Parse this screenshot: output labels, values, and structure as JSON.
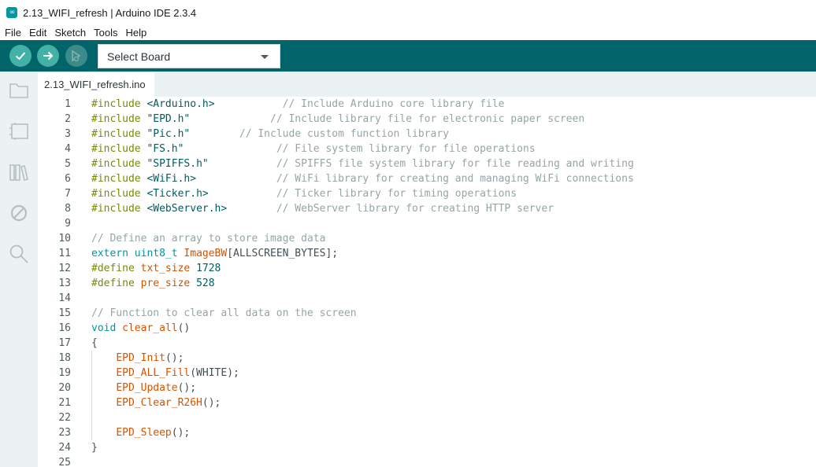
{
  "window": {
    "title": "2.13_WIFI_refresh | Arduino IDE 2.3.4",
    "logo_text": "∞"
  },
  "menu": [
    "File",
    "Edit",
    "Sketch",
    "Tools",
    "Help"
  ],
  "toolbar": {
    "verify_icon": "check-icon",
    "upload_icon": "arrow-right-icon",
    "debug_icon": "debug-icon",
    "board_select": "Select Board"
  },
  "sidebar": [
    "folder-icon",
    "board-manager-icon",
    "library-icon",
    "debug-off-icon",
    "search-icon"
  ],
  "tab": {
    "label": "2.13_WIFI_refresh.ino"
  },
  "code_lines": [
    {
      "n": "1",
      "indent": 0,
      "tokens": [
        [
          "pre",
          "#include "
        ],
        [
          "str",
          "<Arduino.h>"
        ],
        [
          "sp",
          "           "
        ],
        [
          "cmt",
          "// Include Arduino core library file"
        ]
      ]
    },
    {
      "n": "2",
      "indent": 0,
      "tokens": [
        [
          "pre",
          "#include "
        ],
        [
          "str",
          "\"EPD.h\""
        ],
        [
          "sp",
          "             "
        ],
        [
          "cmt",
          "// Include library file for electronic paper screen"
        ]
      ]
    },
    {
      "n": "3",
      "indent": 0,
      "tokens": [
        [
          "pre",
          "#include "
        ],
        [
          "str",
          "\"Pic.h\""
        ],
        [
          "sp",
          "        "
        ],
        [
          "cmt",
          "// Include custom function library"
        ]
      ]
    },
    {
      "n": "4",
      "indent": 0,
      "tokens": [
        [
          "pre",
          "#include "
        ],
        [
          "str",
          "\"FS.h\""
        ],
        [
          "sp",
          "               "
        ],
        [
          "cmt",
          "// File system library for file operations"
        ]
      ]
    },
    {
      "n": "5",
      "indent": 0,
      "tokens": [
        [
          "pre",
          "#include "
        ],
        [
          "str",
          "\"SPIFFS.h\""
        ],
        [
          "sp",
          "           "
        ],
        [
          "cmt",
          "// SPIFFS file system library for file reading and writing"
        ]
      ]
    },
    {
      "n": "6",
      "indent": 0,
      "tokens": [
        [
          "pre",
          "#include "
        ],
        [
          "str",
          "<WiFi.h>"
        ],
        [
          "sp",
          "             "
        ],
        [
          "cmt",
          "// WiFi library for creating and managing WiFi connections"
        ]
      ]
    },
    {
      "n": "7",
      "indent": 0,
      "tokens": [
        [
          "pre",
          "#include "
        ],
        [
          "str",
          "<Ticker.h>"
        ],
        [
          "sp",
          "           "
        ],
        [
          "cmt",
          "// Ticker library for timing operations"
        ]
      ]
    },
    {
      "n": "8",
      "indent": 0,
      "tokens": [
        [
          "pre",
          "#include "
        ],
        [
          "str",
          "<WebServer.h>"
        ],
        [
          "sp",
          "        "
        ],
        [
          "cmt",
          "// WebServer library for creating HTTP server"
        ]
      ]
    },
    {
      "n": "9",
      "indent": 0,
      "tokens": []
    },
    {
      "n": "10",
      "indent": 0,
      "tokens": [
        [
          "cmt",
          "// Define an array to store image data"
        ]
      ]
    },
    {
      "n": "11",
      "indent": 0,
      "tokens": [
        [
          "kw",
          "extern "
        ],
        [
          "kw",
          "uint8_t "
        ],
        [
          "fn",
          "ImageBW"
        ],
        [
          "id",
          "[ALLSCREEN_BYTES];"
        ]
      ]
    },
    {
      "n": "12",
      "indent": 0,
      "tokens": [
        [
          "pre",
          "#define "
        ],
        [
          "fn",
          "txt_size "
        ],
        [
          "num",
          "1728"
        ]
      ]
    },
    {
      "n": "13",
      "indent": 0,
      "tokens": [
        [
          "pre",
          "#define "
        ],
        [
          "fn",
          "pre_size "
        ],
        [
          "num",
          "528"
        ]
      ]
    },
    {
      "n": "14",
      "indent": 0,
      "tokens": []
    },
    {
      "n": "15",
      "indent": 0,
      "tokens": [
        [
          "cmt",
          "// Function to clear all data on the screen"
        ]
      ]
    },
    {
      "n": "16",
      "indent": 0,
      "tokens": [
        [
          "kw",
          "void "
        ],
        [
          "fn",
          "clear_all"
        ],
        [
          "id",
          "()"
        ]
      ]
    },
    {
      "n": "17",
      "indent": 0,
      "tokens": [
        [
          "id",
          "{"
        ]
      ]
    },
    {
      "n": "18",
      "indent": 1,
      "tokens": [
        [
          "fn",
          "EPD_Init"
        ],
        [
          "id",
          "();"
        ]
      ]
    },
    {
      "n": "19",
      "indent": 1,
      "tokens": [
        [
          "fn",
          "EPD_ALL_Fill"
        ],
        [
          "id",
          "(WHITE);"
        ]
      ]
    },
    {
      "n": "20",
      "indent": 1,
      "tokens": [
        [
          "fn",
          "EPD_Update"
        ],
        [
          "id",
          "();"
        ]
      ]
    },
    {
      "n": "21",
      "indent": 1,
      "tokens": [
        [
          "fn",
          "EPD_Clear_R26H"
        ],
        [
          "id",
          "();"
        ]
      ]
    },
    {
      "n": "22",
      "indent": 1,
      "tokens": []
    },
    {
      "n": "23",
      "indent": 1,
      "tokens": [
        [
          "fn",
          "EPD_Sleep"
        ],
        [
          "id",
          "();"
        ]
      ]
    },
    {
      "n": "24",
      "indent": 0,
      "tokens": [
        [
          "id",
          "}"
        ]
      ]
    },
    {
      "n": "25",
      "indent": 0,
      "tokens": []
    }
  ]
}
